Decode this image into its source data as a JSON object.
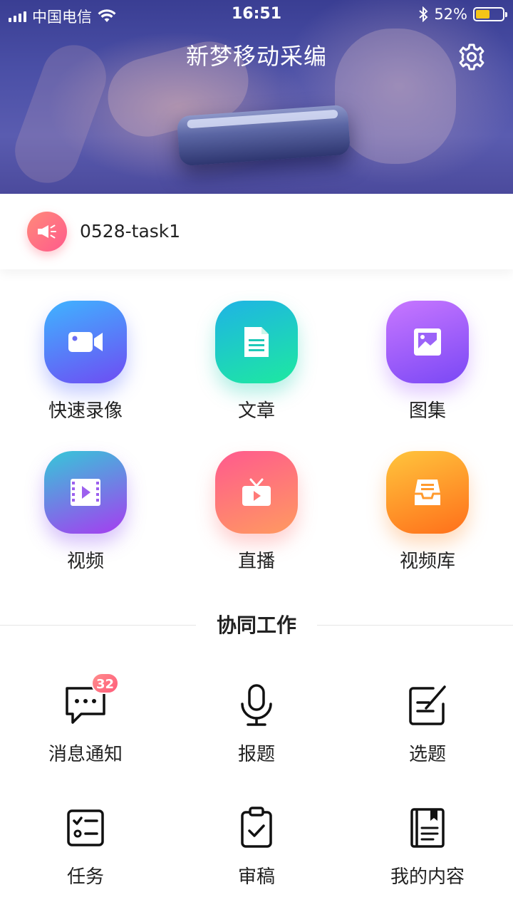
{
  "status_bar": {
    "carrier": "中国电信",
    "time": "16:51",
    "battery": "52%"
  },
  "header": {
    "title": "新梦移动采编",
    "settings_icon": "gear-icon"
  },
  "notice": {
    "icon": "megaphone-icon",
    "text": "0528-task1"
  },
  "features": [
    {
      "label": "快速录像",
      "icon": "video-camera-icon"
    },
    {
      "label": "文章",
      "icon": "document-icon"
    },
    {
      "label": "图集",
      "icon": "image-icon"
    },
    {
      "label": "视频",
      "icon": "film-play-icon"
    },
    {
      "label": "直播",
      "icon": "tv-icon"
    },
    {
      "label": "视频库",
      "icon": "archive-tray-icon"
    }
  ],
  "collab": {
    "title": "协同工作",
    "items": [
      {
        "label": "消息通知",
        "icon": "message-icon",
        "badge": "32"
      },
      {
        "label": "报题",
        "icon": "microphone-icon"
      },
      {
        "label": "选题",
        "icon": "edit-note-icon"
      },
      {
        "label": "任务",
        "icon": "checklist-icon"
      },
      {
        "label": "审稿",
        "icon": "clipboard-check-icon"
      },
      {
        "label": "我的内容",
        "icon": "notebook-icon"
      }
    ]
  },
  "colors": {
    "header_bg": "#4a4fa6",
    "badge": "#ff6b80",
    "battery_fill": "#f5c518"
  }
}
